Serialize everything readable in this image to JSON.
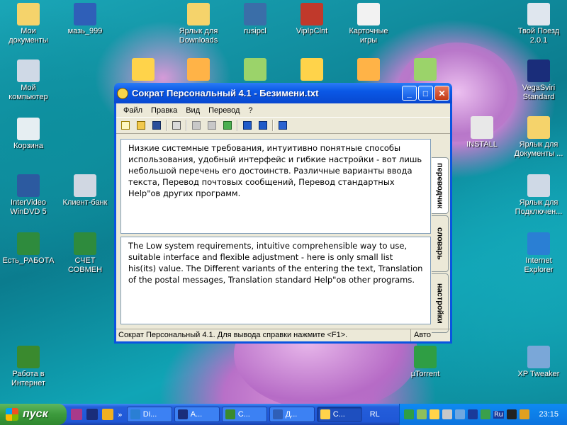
{
  "desktop": {
    "icons_left": [
      {
        "label": "Мои документы",
        "icon": "my-documents-icon",
        "color": "#f5d36b"
      },
      {
        "label": "Мой компьютер",
        "icon": "my-computer-icon",
        "color": "#cfd9e6"
      },
      {
        "label": "Корзина",
        "icon": "recycle-bin-icon",
        "color": "#e6eef2"
      },
      {
        "label": "InterVideo WinDVD 5",
        "icon": "windvd-icon",
        "color": "#2c5aa0"
      },
      {
        "label": "Есть_РАБОТА",
        "icon": "excel-file-icon",
        "color": "#2e8b3d"
      },
      {
        "label": "Работа в Интернет",
        "icon": "tree-icon",
        "color": "#3a8a2e"
      }
    ],
    "icons_col2": [
      {
        "label": "мазь_999",
        "icon": "word-document-icon",
        "color": "#2f5fb8"
      },
      {
        "label": "Клиент-банк",
        "icon": "bank-client-icon",
        "color": "#d0d7e2"
      },
      {
        "label": "СЧЕТ СОВМЕН",
        "icon": "excel-file-icon",
        "color": "#2e8b3d"
      }
    ],
    "icons_top": [
      {
        "label": "Ярлык для Downloads",
        "icon": "folder-shortcut-icon",
        "color": "#f5d36b"
      },
      {
        "label": "rusipcl",
        "icon": "rusip-icon",
        "color": "#3a6ea8"
      },
      {
        "label": "VipIpClnt",
        "icon": "vipip-icon",
        "color": "#c0392b"
      },
      {
        "label": "Карточные игры",
        "icon": "cards-icon",
        "color": "#f2f2f2"
      }
    ],
    "icons_row2": [
      {
        "icon": "sokrat-app-icon-1",
        "color": "#ffd34a"
      },
      {
        "icon": "sokrat-app-icon-2",
        "color": "#ffb347"
      },
      {
        "icon": "sokrat-app-icon-3",
        "color": "#9bd36a"
      },
      {
        "icon": "sokrat-app-icon-4",
        "color": "#ffd34a"
      },
      {
        "icon": "sokrat-app-icon-5",
        "color": "#ffb347"
      },
      {
        "icon": "sokrat-app-icon-6",
        "color": "#9bd36a"
      }
    ],
    "icons_right": [
      {
        "label": "Твой Поезд 2.0.1",
        "icon": "train-icon",
        "color": "#dfe6ee"
      },
      {
        "label": "VegaSviri Standard",
        "icon": "star-icon",
        "color": "#1a2d7a"
      },
      {
        "label": "INSTALL",
        "icon": "ms-install-icon",
        "color": "#e8e8e8"
      },
      {
        "label": "Ярлык для Документы ...",
        "icon": "folder-shortcut-icon",
        "color": "#f5d36b"
      },
      {
        "label": "Ярлык для Подключен...",
        "icon": "network-connection-icon",
        "color": "#cfd9e6"
      },
      {
        "label": "Internet Explorer",
        "icon": "internet-explorer-icon",
        "color": "#2a7fd4"
      },
      {
        "label": "µTorrent",
        "icon": "utorrent-icon",
        "color": "#2f9e44"
      },
      {
        "label": "XP Tweaker",
        "icon": "xp-tweaker-icon",
        "color": "#7aa7d8"
      }
    ]
  },
  "window": {
    "title": "Сократ Персональный 4.1 - Безимени.txt",
    "menu": [
      "Файл",
      "Правка",
      "Вид",
      "Перевод",
      "?"
    ],
    "toolbar_icons": [
      "new-icon",
      "open-icon",
      "save-icon",
      "print-icon",
      "cut-icon",
      "copy-icon",
      "paste-icon",
      "translate-down-icon",
      "translate-up-icon",
      "info-icon"
    ],
    "source_text": "Низкие системные требования, интуитивно понятные способы использования, удобный интерфейс и гибкие настройки - вот лишь небольшой перечень его достоинств. Различные варианты ввода текста, Перевод почтовых сообщений, Перевод стандартных Help\"ов других программ.",
    "translated_text": "The Low system requirements, intuitive comprehensible way to use, suitable interface and flexible adjustment - here is only small list his(its) value. The Different variants of the entering the text, Translation of the postal messages, Translation standard Help\"ов other programs.",
    "tabs": [
      "переводчик",
      "словарь",
      "настройки"
    ],
    "status": "Сократ Персональный  4.1.  Для вывода справки нажмите <F1>.",
    "status_mode": "Авто"
  },
  "taskbar": {
    "start_label": "пуск",
    "quick_launch": [
      "winrar-icon",
      "vegasviri-icon",
      "media-icon"
    ],
    "tasks": [
      {
        "label": "Di...",
        "icon": "internet-explorer-icon",
        "color": "#2a7fd4",
        "active": false
      },
      {
        "label": "A...",
        "icon": "vegasviri-icon",
        "color": "#1a2d7a",
        "active": false
      },
      {
        "label": "C...",
        "icon": "tree-icon",
        "color": "#3a8a2e",
        "active": false
      },
      {
        "label": "Д...",
        "icon": "word-document-icon",
        "color": "#2f5fb8",
        "active": false
      },
      {
        "label": "C...",
        "icon": "sokrat-app-icon",
        "color": "#ffd34a",
        "active": true
      }
    ],
    "language": "RL",
    "tray_icons": [
      "utorrent-tray-icon",
      "network-tray-icon",
      "sokrat-tray-icon",
      "settings-tray-icon",
      "sound-tray-icon",
      "media-player-tray-icon",
      "antivirus-tray-icon",
      "ru-language-tray-icon",
      "bug-tray-icon",
      "star-tray-icon"
    ],
    "tray_lang": "Ru",
    "clock": "23:15"
  },
  "colors": {
    "titlebar": "#0a58e6",
    "start_button": "#3c9a3c",
    "taskbar": "#1f57d6",
    "tray": "#0e8af2"
  }
}
